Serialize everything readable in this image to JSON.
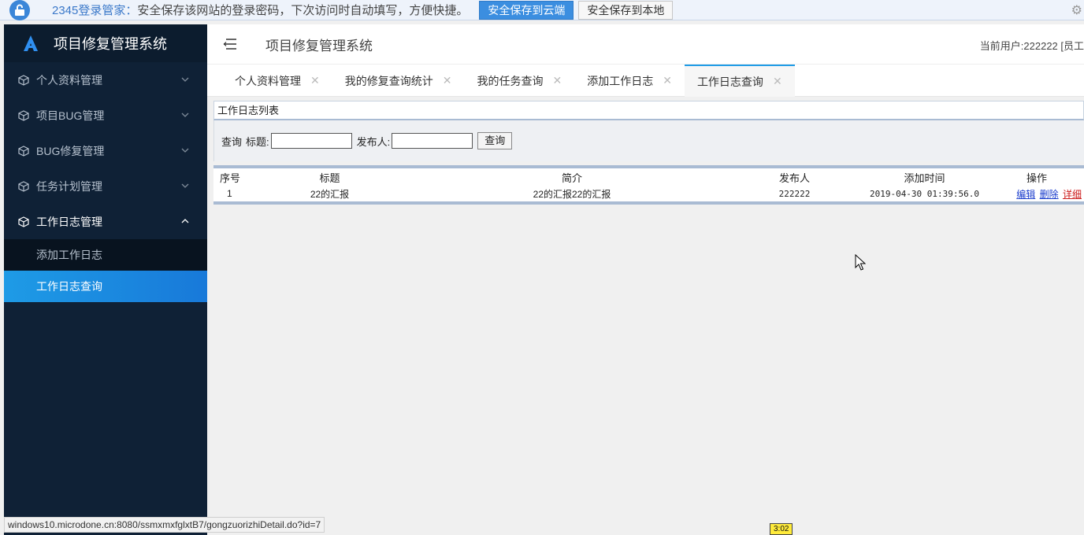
{
  "pw_bar": {
    "brand": "2345登录管家：",
    "message": "安全保存该网站的登录密码，下次访问时自动填写，方便快捷。",
    "cloud_button": "安全保存到云端",
    "local_button": "安全保存到本地",
    "icons": [
      "lock-icon",
      "gear-icon"
    ]
  },
  "sidebar": {
    "title": "项目修复管理系统",
    "items": [
      {
        "label": "个人资料管理",
        "icon": "cube-icon",
        "expanded": false
      },
      {
        "label": "项目BUG管理",
        "icon": "cube-icon",
        "expanded": false
      },
      {
        "label": "BUG修复管理",
        "icon": "cube-icon",
        "expanded": false
      },
      {
        "label": "任务计划管理",
        "icon": "cube-icon",
        "expanded": false
      },
      {
        "label": "工作日志管理",
        "icon": "cube-icon",
        "expanded": true
      }
    ],
    "submenu": [
      {
        "label": "添加工作日志",
        "active": false
      },
      {
        "label": "工作日志查询",
        "active": true
      }
    ],
    "active_color": "#1e9be6"
  },
  "header": {
    "title": "项目修复管理系统",
    "user": "当前用户:222222 [员工"
  },
  "tabs": [
    {
      "label": "个人资料管理",
      "active": false
    },
    {
      "label": "我的修复查询统计",
      "active": false
    },
    {
      "label": "我的任务查询",
      "active": false
    },
    {
      "label": "添加工作日志",
      "active": false
    },
    {
      "label": "工作日志查询",
      "active": true
    }
  ],
  "panel": {
    "title": "工作日志列表",
    "search": {
      "prefix": "查询",
      "title_label": "标题:",
      "title_value": "",
      "publisher_label": "发布人:",
      "publisher_value": "",
      "button": "查询"
    },
    "table": {
      "headers": [
        "序号",
        "标题",
        "简介",
        "发布人",
        "添加时间",
        "操作"
      ],
      "rows": [
        {
          "idx": "1",
          "title": "22的汇报",
          "summary": "22的汇报22的汇报",
          "publisher": "222222",
          "time": "2019-04-30 01:39:56.0",
          "ops": [
            "编辑",
            "删除",
            "详细"
          ]
        }
      ]
    }
  },
  "status_url": "windows10.microdone.cn:8080/ssmxmxfglxtB7/gongzuorizhiDetail.do?id=7",
  "time_badge": "3:02"
}
